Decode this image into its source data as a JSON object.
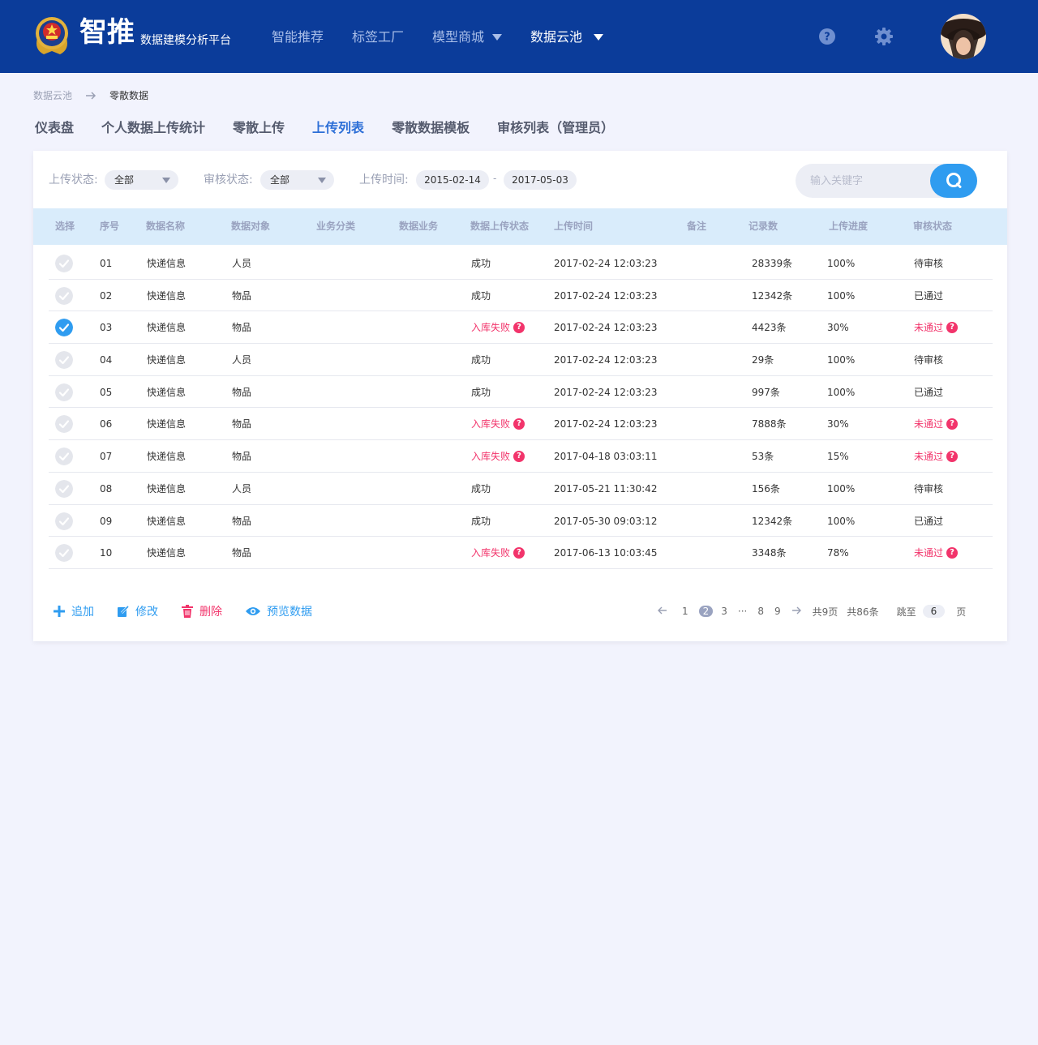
{
  "header": {
    "brand": "智推",
    "subtitle": "数据建模分析平台",
    "nav": [
      {
        "label": "智能推荐",
        "dropdown": false,
        "active": false
      },
      {
        "label": "标签工厂",
        "dropdown": false,
        "active": false
      },
      {
        "label": "模型商城",
        "dropdown": true,
        "active": false
      },
      {
        "label": "数据云池",
        "dropdown": true,
        "active": true
      }
    ],
    "help_icon": "question-circle-icon",
    "settings_icon": "gear-icon"
  },
  "breadcrumb": {
    "parent": "数据云池",
    "current": "零散数据"
  },
  "tabs": [
    {
      "label": "仪表盘",
      "active": false
    },
    {
      "label": "个人数据上传统计",
      "active": false
    },
    {
      "label": "零散上传",
      "active": false
    },
    {
      "label": "上传列表",
      "active": true
    },
    {
      "label": "零散数据模板",
      "active": false
    },
    {
      "label": "审核列表（管理员）",
      "active": false
    }
  ],
  "filters": {
    "upload_status_label": "上传状态:",
    "upload_status_value": "全部",
    "review_status_label": "审核状态:",
    "review_status_value": "全部",
    "upload_time_label": "上传时间:",
    "date_from": "2015-02-14",
    "date_sep": "-",
    "date_to": "2017-05-03",
    "search_placeholder": "输入关键字"
  },
  "table": {
    "headers": [
      "选择",
      "序号",
      "数据名称",
      "数据对象",
      "业务分类",
      "数据业务",
      "数据上传状态",
      "上传时间",
      "备注",
      "记录数",
      "上传进度",
      "审核状态"
    ],
    "rows": [
      {
        "checked": false,
        "no": "01",
        "name": "快递信息",
        "object": "人员",
        "category": "",
        "business": "",
        "status": "成功",
        "status_fail": false,
        "time": "2017-02-24  12:03:23",
        "remark": "",
        "records": "28339条",
        "progress": "100%",
        "review": "待审核",
        "review_fail": false
      },
      {
        "checked": false,
        "no": "02",
        "name": "快递信息",
        "object": "物品",
        "category": "",
        "business": "",
        "status": "成功",
        "status_fail": false,
        "time": "2017-02-24  12:03:23",
        "remark": "",
        "records": "12342条",
        "progress": "100%",
        "review": "已通过",
        "review_fail": false
      },
      {
        "checked": true,
        "no": "03",
        "name": "快递信息",
        "object": "物品",
        "category": "",
        "business": "",
        "status": "入库失败",
        "status_fail": true,
        "time": "2017-02-24  12:03:23",
        "remark": "",
        "records": "4423条",
        "progress": "30%",
        "review": "未通过",
        "review_fail": true
      },
      {
        "checked": false,
        "no": "04",
        "name": "快递信息",
        "object": "人员",
        "category": "",
        "business": "",
        "status": "成功",
        "status_fail": false,
        "time": "2017-02-24  12:03:23",
        "remark": "",
        "records": "29条",
        "progress": "100%",
        "review": "待审核",
        "review_fail": false
      },
      {
        "checked": false,
        "no": "05",
        "name": "快递信息",
        "object": "物品",
        "category": "",
        "business": "",
        "status": "成功",
        "status_fail": false,
        "time": "2017-02-24  12:03:23",
        "remark": "",
        "records": "997条",
        "progress": "100%",
        "review": "已通过",
        "review_fail": false
      },
      {
        "checked": false,
        "no": "06",
        "name": "快递信息",
        "object": "物品",
        "category": "",
        "business": "",
        "status": "入库失败",
        "status_fail": true,
        "time": "2017-02-24  12:03:23",
        "remark": "",
        "records": "7888条",
        "progress": "30%",
        "review": "未通过",
        "review_fail": true
      },
      {
        "checked": false,
        "no": "07",
        "name": "快递信息",
        "object": "物品",
        "category": "",
        "business": "",
        "status": "入库失败",
        "status_fail": true,
        "time": "2017-04-18  03:03:11",
        "remark": "",
        "records": "53条",
        "progress": "15%",
        "review": "未通过",
        "review_fail": true
      },
      {
        "checked": false,
        "no": "08",
        "name": "快递信息",
        "object": "人员",
        "category": "",
        "business": "",
        "status": "成功",
        "status_fail": false,
        "time": "2017-05-21  11:30:42",
        "remark": "",
        "records": "156条",
        "progress": "100%",
        "review": "待审核",
        "review_fail": false
      },
      {
        "checked": false,
        "no": "09",
        "name": "快递信息",
        "object": "物品",
        "category": "",
        "business": "",
        "status": "成功",
        "status_fail": false,
        "time": "2017-05-30  09:03:12",
        "remark": "",
        "records": "12342条",
        "progress": "100%",
        "review": "已通过",
        "review_fail": false
      },
      {
        "checked": false,
        "no": "10",
        "name": "快递信息",
        "object": "物品",
        "category": "",
        "business": "",
        "status": "入库失败",
        "status_fail": true,
        "time": "2017-06-13 10:03:45",
        "remark": "",
        "records": "3348条",
        "progress": "78%",
        "review": "未通过",
        "review_fail": true
      }
    ]
  },
  "actions": [
    {
      "label": "追加",
      "icon": "plus-icon",
      "danger": false
    },
    {
      "label": "修改",
      "icon": "edit-icon",
      "danger": false
    },
    {
      "label": "删除",
      "icon": "trash-icon",
      "danger": true
    },
    {
      "label": "预览数据",
      "icon": "eye-icon",
      "danger": false
    }
  ],
  "pagination": {
    "pages": [
      "1",
      "2",
      "3",
      "···",
      "8",
      "9"
    ],
    "current": "2",
    "total_pages": "共9页",
    "total_items": "共86条",
    "jump_label": "跳至",
    "jump_value": "6",
    "page_suffix": "页"
  },
  "colors": {
    "header_bg": "#0b3c9a",
    "accent": "#2f9cf0",
    "danger": "#f2346b",
    "active_tab": "#2d6fd7",
    "table_header_bg": "#d9ecfb"
  }
}
